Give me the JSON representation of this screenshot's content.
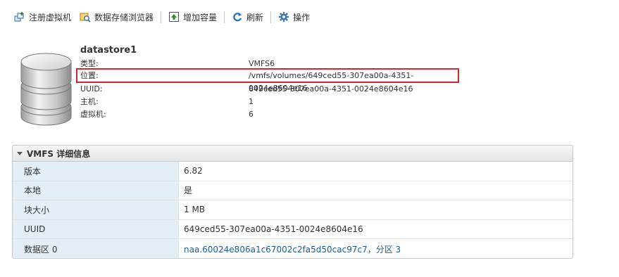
{
  "toolbar": {
    "register_vm": "注册虚拟机",
    "datastore_browser": "数据存储浏览器",
    "increase_capacity": "增加容量",
    "refresh": "刷新",
    "actions": "操作"
  },
  "datastore": {
    "name": "datastore1",
    "properties": [
      {
        "label": "类型:",
        "value": "VMFS6"
      },
      {
        "label": "位置:",
        "value": "/vmfs/volumes/649ced55-307ea00a-4351-0024e8604e16"
      },
      {
        "label": "UUID:",
        "value": "649ced55-307ea00a-4351-0024e8604e16"
      },
      {
        "label": "主机:",
        "value": "1"
      },
      {
        "label": "虚拟机:",
        "value": "6"
      }
    ]
  },
  "highlight_color": "#d9232d",
  "vmfs_details": {
    "title": "VMFS 详细信息",
    "rows": [
      {
        "key": "版本",
        "value": "6.82"
      },
      {
        "key": "本地",
        "value": "是"
      },
      {
        "key": "块大小",
        "value": "1 MB"
      },
      {
        "key": "UUID",
        "value": "649ced55-307ea00a-4351-0024e8604e16"
      },
      {
        "key": "数据区 0",
        "value": "naa.60024e806a1c67002c2fa5d50cac97c7，分区 3"
      }
    ]
  },
  "icons": {
    "register_vm": "register-vm-icon",
    "datastore_browser": "datastore-browser-icon",
    "increase_capacity": "increase-capacity-icon",
    "refresh": "refresh-icon",
    "actions": "gear-icon",
    "datastore": "database-icon"
  }
}
